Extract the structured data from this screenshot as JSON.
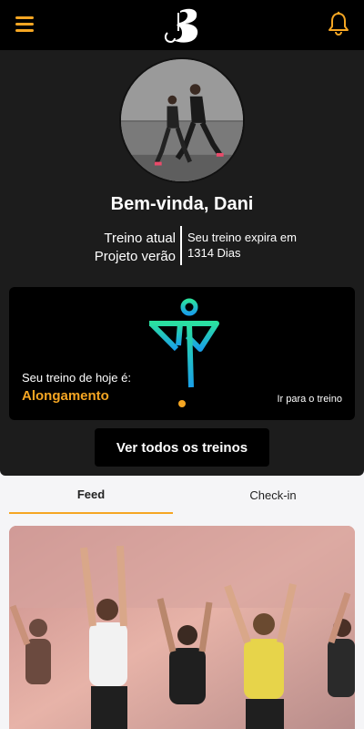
{
  "header": {
    "menu_icon": "hamburger-menu-icon",
    "notification_icon": "bell-icon",
    "logo_letter": "B",
    "accent_color": "#f5a623"
  },
  "profile": {
    "greeting": "Bem-vinda, Dani",
    "current_label": "Treino atual",
    "current_plan": "Projeto verão",
    "expiry_label": "Seu treino expira em",
    "expiry_value": "1314 Dias"
  },
  "today": {
    "caption": "Seu treino de hoje é:",
    "workout": "Alongamento",
    "link": "Ir para o treino"
  },
  "buttons": {
    "all_workouts": "Ver todos os treinos"
  },
  "tabs": [
    {
      "label": "Feed",
      "active": true
    },
    {
      "label": "Check-in",
      "active": false
    }
  ]
}
